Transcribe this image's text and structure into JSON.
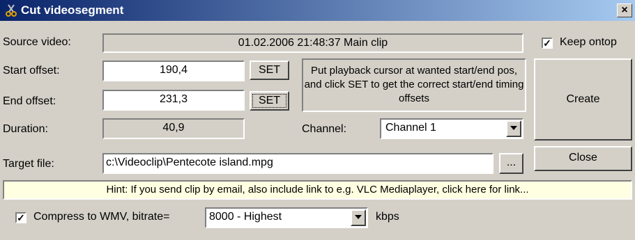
{
  "window": {
    "title": "Cut videosegment",
    "close_glyph": "×",
    "icon": "scissors-icon"
  },
  "source": {
    "label": "Source video:",
    "value": "01.02.2006 21:48:37 Main clip"
  },
  "keep_ontop": {
    "label": "Keep ontop",
    "checked": true
  },
  "start": {
    "label": "Start offset:",
    "value": "190,4",
    "set_label": "SET"
  },
  "end": {
    "label": "End offset:",
    "value": "231,3",
    "set_label": "SET"
  },
  "duration": {
    "label": "Duration:",
    "value": "40,9"
  },
  "info_text": "Put playback cursor at wanted start/end pos, and click SET to get the correct start/end timing offsets",
  "channel": {
    "label": "Channel:",
    "value": "Channel 1"
  },
  "create_label": "Create",
  "close_label": "Close",
  "target": {
    "label": "Target file:",
    "value": "c:\\Videoclip\\Pentecote island.mpg",
    "browse_label": "..."
  },
  "hint": "Hint: If you send clip by email, also include link to e.g. VLC Mediaplayer, click here for link...",
  "compress": {
    "label": "Compress to WMV, bitrate=",
    "checked": true,
    "bitrate": "8000 - Highest",
    "unit": "kbps"
  },
  "colors": {
    "hint_bg": "#ffffe1",
    "titlebar_start": "#0a246a",
    "titlebar_end": "#a6caf0",
    "face": "#d4d0c8"
  }
}
